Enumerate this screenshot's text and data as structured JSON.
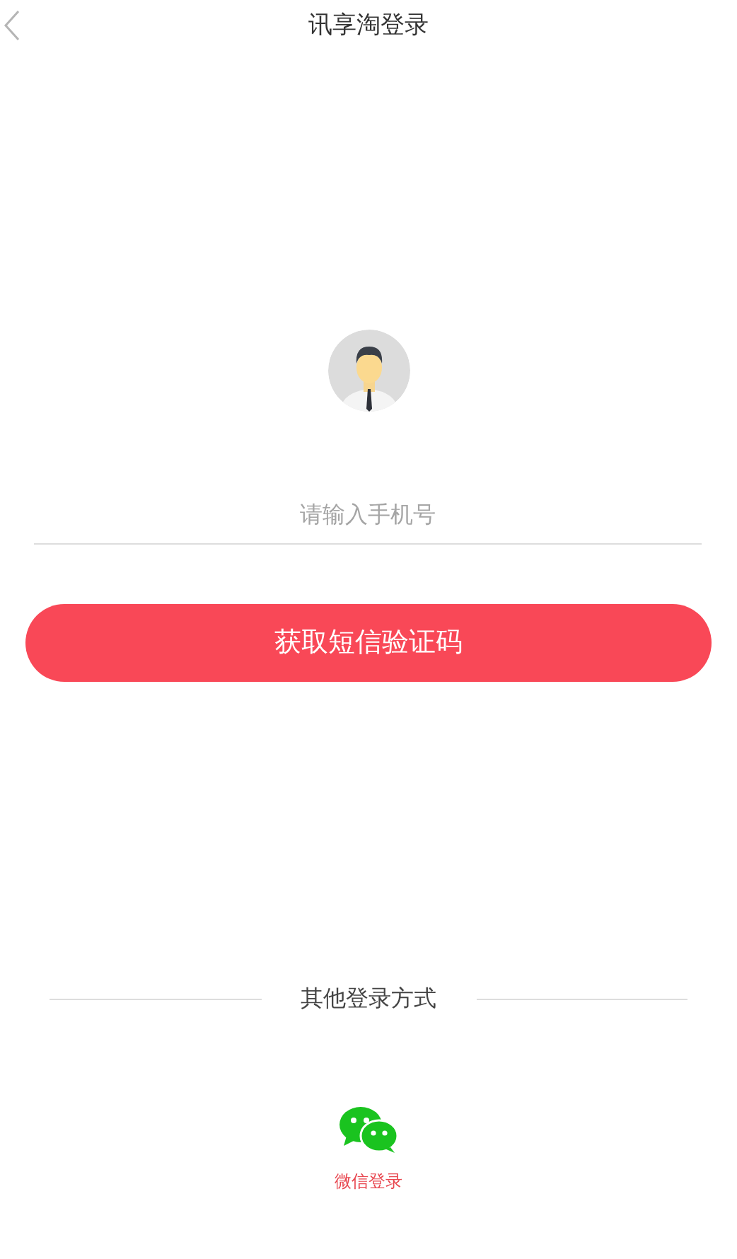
{
  "header": {
    "title": "讯享淘登录"
  },
  "phone_field": {
    "placeholder": "请输入手机号"
  },
  "submit_button": {
    "label": "获取短信验证码"
  },
  "other_login": {
    "heading": "其他登录方式",
    "options": [
      {
        "kind": "wechat",
        "label": "微信登录"
      }
    ]
  }
}
